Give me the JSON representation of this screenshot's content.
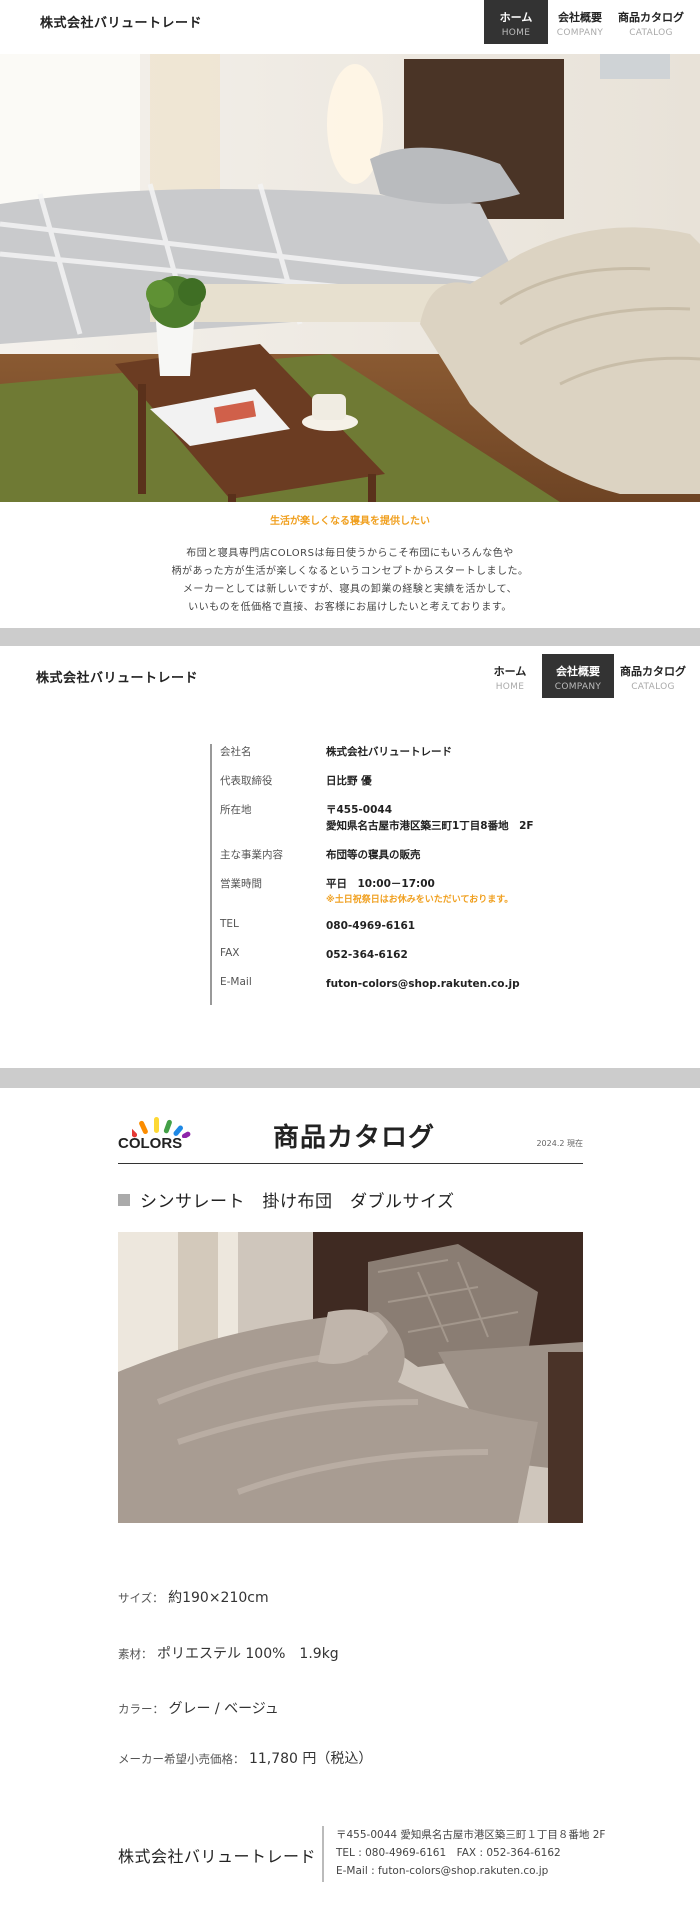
{
  "header": {
    "brand": "株式会社バリュートレード",
    "nav": [
      {
        "jp": "ホーム",
        "en": "HOME"
      },
      {
        "jp": "会社概要",
        "en": "COMPANY"
      },
      {
        "jp": "商品カタログ",
        "en": "CATALOG"
      }
    ]
  },
  "intro": {
    "tagline": "生活が楽しくなる寝具を提供したい",
    "lines": [
      "布団と寝具専門店COLORSは毎日使うからこそ布団にもいろんな色や",
      "柄があった方が生活が楽しくなるというコンセプトからスタートしました。",
      "メーカーとしては新しいですが、寝具の卸業の経験と実績を活かして、",
      "いいものを低価格で直接、お客様にお届けしたいと考えております。"
    ]
  },
  "company": {
    "rows": [
      {
        "key": "会社名",
        "value": "株式会社バリュートレード"
      },
      {
        "key": "代表取締役",
        "value": "日比野 優"
      },
      {
        "key": "所在地",
        "value": "〒455-0044",
        "value2": "愛知県名古屋市港区築三町1丁目8番地　2F"
      },
      {
        "key": "主な事業内容",
        "value": "布団等の寝具の販売"
      },
      {
        "key": "営業時間",
        "value": "平日　10:00－17:00",
        "note": "※土日祝祭日はお休みをいただいております。"
      },
      {
        "key": "TEL",
        "value": "080-4969-6161"
      },
      {
        "key": "FAX",
        "value": "052-364-6162"
      },
      {
        "key": "E-Mail",
        "value": "futon-colors@shop.rakuten.co.jp"
      }
    ]
  },
  "catalog": {
    "logo_text": "COLORS",
    "logo_colors": [
      "#e53935",
      "#fb8c00",
      "#fdd835",
      "#43a047",
      "#1e88e5",
      "#8e24aa"
    ],
    "title": "商品カタログ",
    "date": "2024.2 現在",
    "product_name": "シンサレート　掛け布団　ダブルサイズ",
    "specs": [
      {
        "label": "サイズ：",
        "value": "約190×210cm"
      },
      {
        "label": "素材：",
        "value": "ポリエステル 100%　1.9kg"
      },
      {
        "label": "カラー：",
        "value": "グレー / ベージュ"
      },
      {
        "label": "メーカー希望小売価格：",
        "value": "11,780 円（税込）"
      }
    ]
  },
  "footer": {
    "name": "株式会社バリュートレード",
    "address": "〒455-0044 愛知県名古屋市港区築三町１丁目８番地 2F",
    "telfax": "TEL : 080-4969-6161　FAX : 052-364-6162",
    "email": "E-Mail : futon-colors@shop.rakuten.co.jp"
  },
  "colors": {
    "accent": "#f0a020",
    "nav_active": "#333333",
    "band": "#cccccc"
  }
}
